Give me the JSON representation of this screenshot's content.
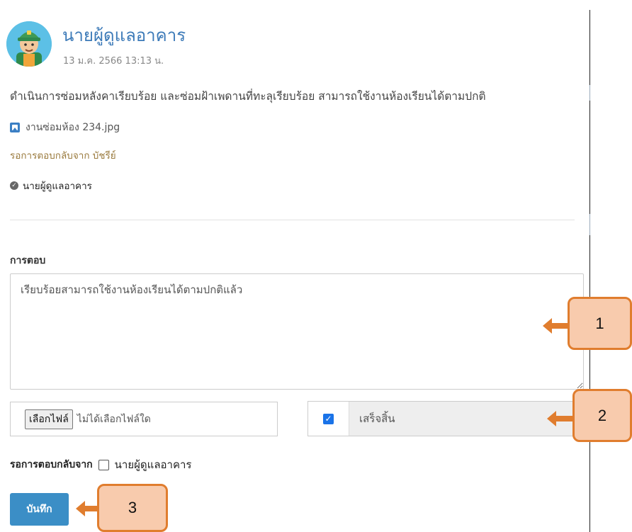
{
  "post": {
    "author": "นายผู้ดูแลอาคาร",
    "timestamp": "13 ม.ค. 2566 13:13 น.",
    "message": "ดำเนินการซ่อมหลังคาเรียบร้อย และซ่อมฝ้าเพดานที่ทะลุเรียบร้อย สามารถใช้งานห้องเรียนได้ตามปกติ",
    "attachment": "งานซ่อมห้อง 234.jpg",
    "waiting_from": "รอการตอบกลับจาก บัชรีย์",
    "approver": "นายผู้ดูแลอาคาร"
  },
  "reply": {
    "label": "การตอบ",
    "text": "เรียบร้อยสามารถใช้งานห้องเรียนได้ตามปกติแล้ว"
  },
  "file": {
    "button": "เลือกไฟล์",
    "status": "ไม่ได้เลือกไฟล์ใด"
  },
  "done": {
    "label": "เสร็จสิ้น",
    "checked": true
  },
  "waiting": {
    "label": "รอการตอบกลับจาก",
    "option": "นายผู้ดูแลอาคาร",
    "checked": false
  },
  "save_button": "บันทึก",
  "callouts": [
    "1",
    "2",
    "3"
  ],
  "colors": {
    "accent": "#3c7ab8",
    "save": "#3b8ec6",
    "callout_fill": "#f8cbad",
    "callout_border": "#e07d2e"
  }
}
